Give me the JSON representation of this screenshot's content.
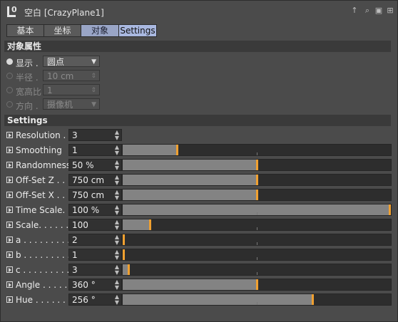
{
  "header": {
    "title": "空白 [CrazyPlane1]",
    "icon": "null-object-icon",
    "icon_glyph": "0"
  },
  "tabs": [
    {
      "label": "基本",
      "active": false
    },
    {
      "label": "坐标",
      "active": false
    },
    {
      "label": "对象",
      "active": true
    },
    {
      "label": "Settings",
      "active": true
    }
  ],
  "object_section": {
    "title": "对象属性",
    "rows": [
      {
        "label": "显示 .",
        "value": "圆点",
        "enabled": true
      },
      {
        "label": "半径 .",
        "value": "10 cm",
        "enabled": false
      },
      {
        "label": "宽高比",
        "value": "1",
        "enabled": false
      },
      {
        "label": "方向 .",
        "value": "摄像机",
        "enabled": false
      }
    ]
  },
  "settings_section": {
    "title": "Settings",
    "rows": [
      {
        "label": "Resolution . .",
        "value": "3",
        "slider": null
      },
      {
        "label": "Smoothing",
        "value": "1",
        "slider": 0.2
      },
      {
        "label": "Randomness",
        "value": "50 %",
        "slider": 0.5
      },
      {
        "label": "Off-Set Z . . .",
        "value": "750 cm",
        "slider": 0.5
      },
      {
        "label": "Off-Set X . . .",
        "value": "750 cm",
        "slider": 0.5
      },
      {
        "label": "Time Scale. . .",
        "value": "100 %",
        "slider": 1.0
      },
      {
        "label": "Scale. . . . . . .",
        "value": "100",
        "slider": 0.1
      },
      {
        "label": "a . . . . . . . . . .",
        "value": "2",
        "slider": 0.0
      },
      {
        "label": "b . . . . . . . . . .",
        "value": "1",
        "slider": 0.0
      },
      {
        "label": "c . . . . . . . . . .",
        "value": "3",
        "slider": 0.02
      },
      {
        "label": "Angle . . . . .",
        "value": "360 °",
        "slider": 0.5
      },
      {
        "label": "Hue . . . . . .",
        "value": "256 °",
        "slider": 0.71
      }
    ]
  },
  "colors": {
    "background": "#4b4b4b",
    "accent_knob": "#f0a030",
    "tab_active": "#99a5c6"
  }
}
